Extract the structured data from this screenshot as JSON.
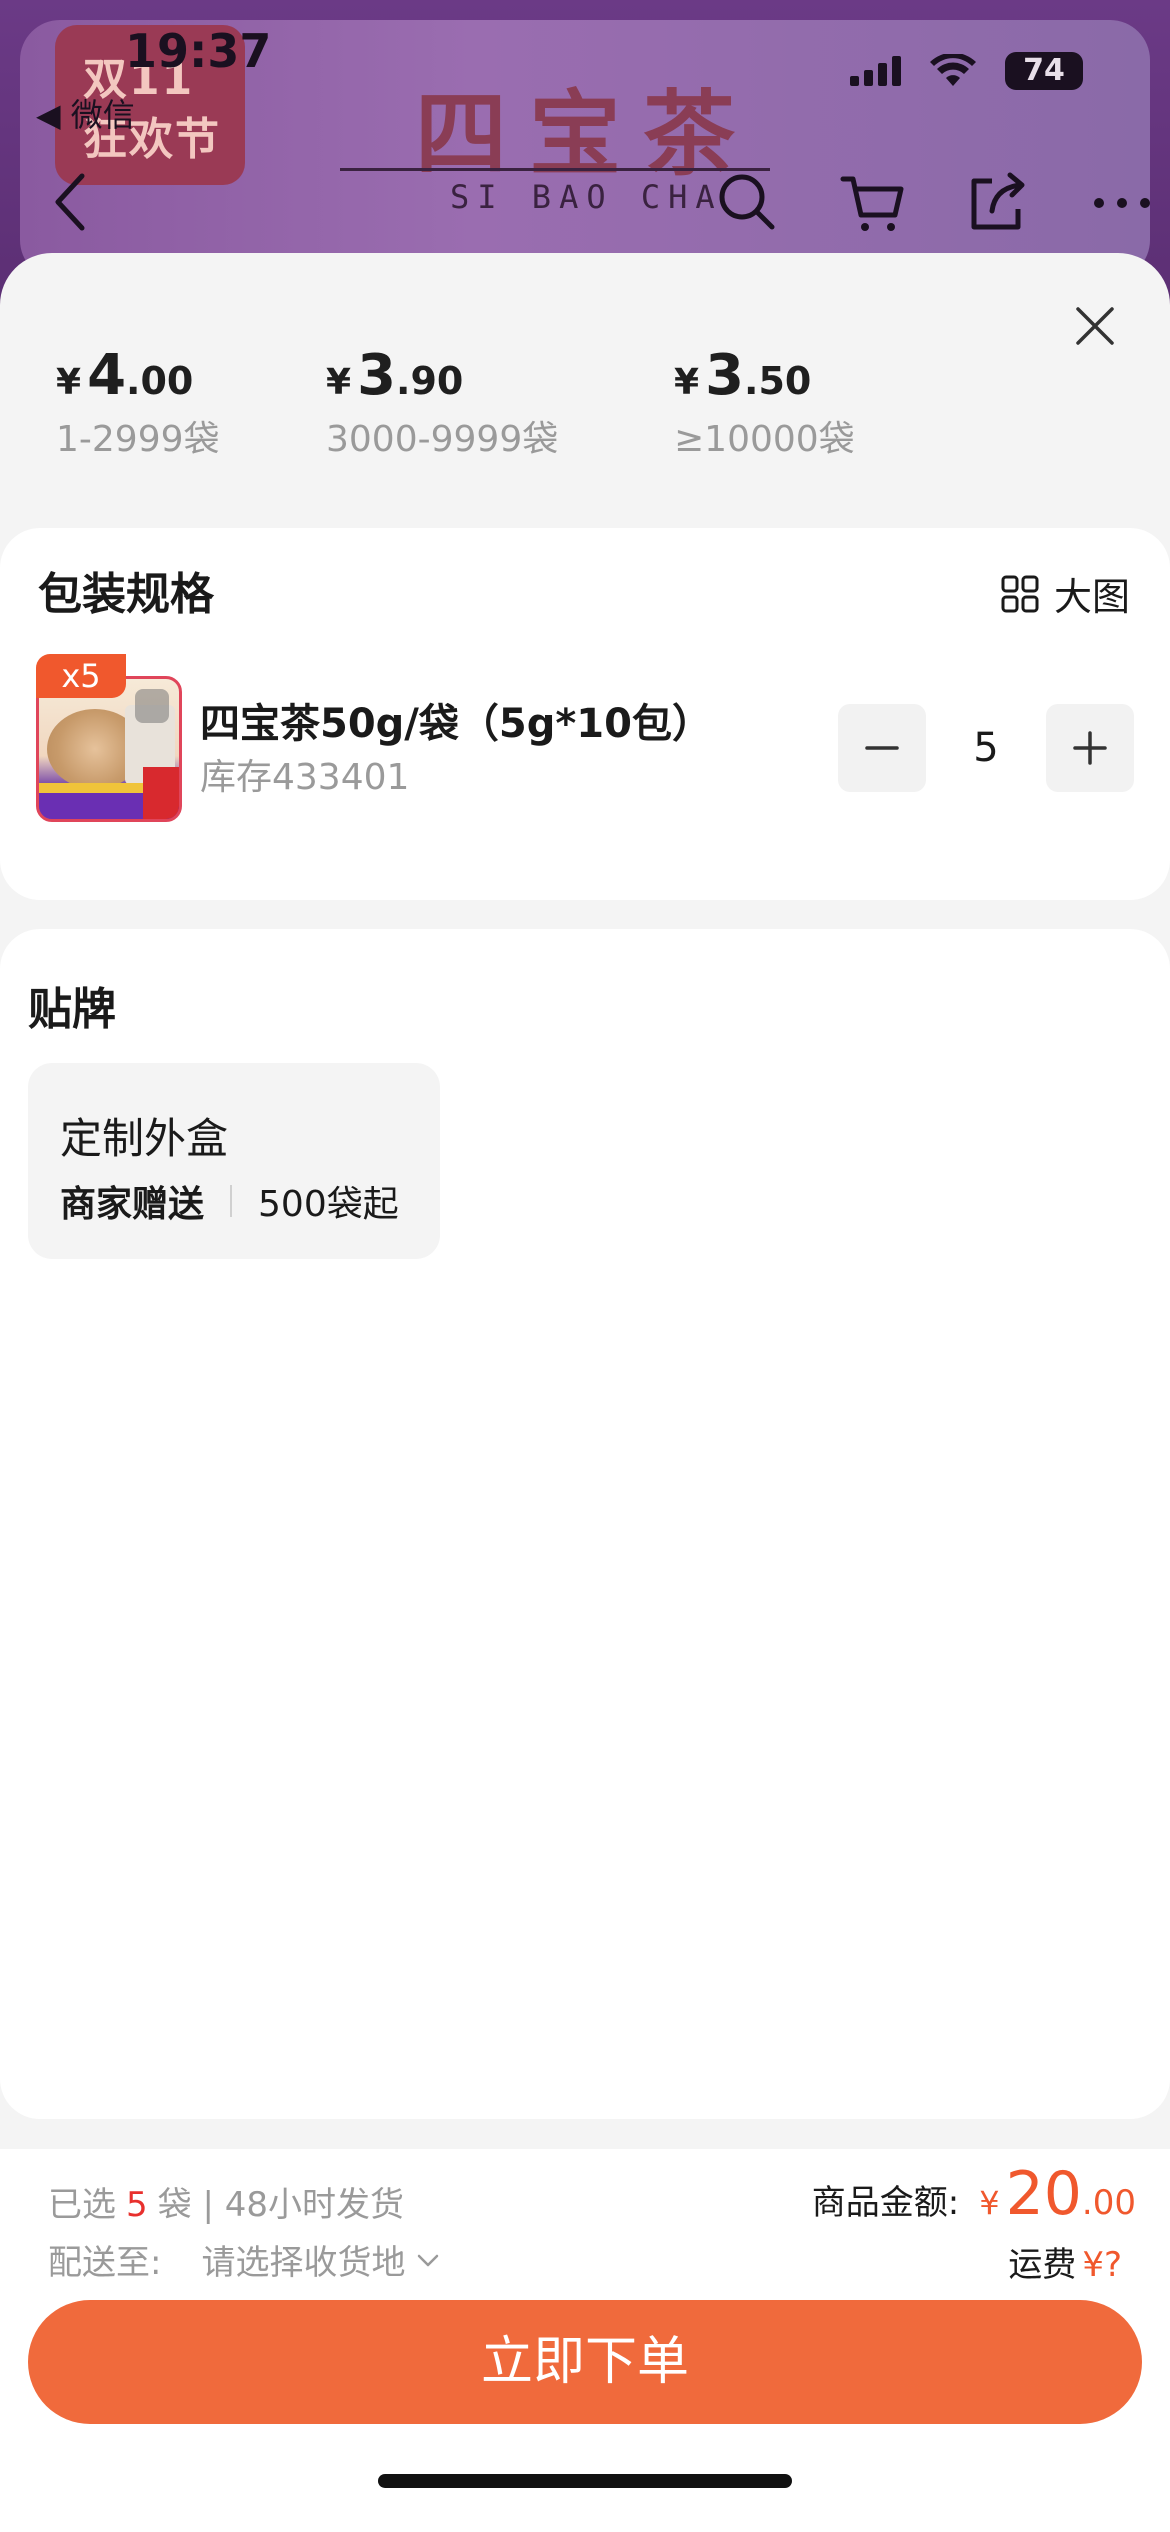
{
  "status_bar": {
    "time": "19:37",
    "back_app": "◀ 微信",
    "battery": "74"
  },
  "background_page": {
    "festival_badge": "双11\n狂欢节",
    "brand_name": "四宝茶",
    "brand_pinyin": "SI BAO CHA"
  },
  "price_tiers": [
    {
      "currency": "¥",
      "int": "4",
      "dec": ".00",
      "range": "1-2999袋"
    },
    {
      "currency": "¥",
      "int": "3",
      "dec": ".90",
      "range": "3000-9999袋"
    },
    {
      "currency": "¥",
      "int": "3",
      "dec": ".50",
      "range": "≥10000袋"
    }
  ],
  "spec_section": {
    "title": "包装规格",
    "big_picture_label": "大图",
    "product": {
      "qty_badge": "x5",
      "name": "四宝茶50g/袋（5g*10包）",
      "stock": "库存433401",
      "quantity": "5"
    }
  },
  "label_section": {
    "title": "贴牌",
    "option": {
      "title": "定制外盒",
      "gift": "商家赠送",
      "minimum": "500袋起"
    }
  },
  "footer": {
    "selected_prefix": "已选",
    "selected_count": "5",
    "selected_suffix": "袋 | 48小时发货",
    "ship_to_label": "配送至:",
    "ship_to_placeholder": "请选择收货地",
    "amount_label": "商品金额:",
    "amount_currency": "¥",
    "amount_int": "20",
    "amount_dec": ".00",
    "freight_label": "运费",
    "freight_value": "¥?",
    "order_button": "立即下单"
  },
  "colors": {
    "accent": "#f06a3c",
    "price_red": "#f0582d",
    "background_purple": "#5c2f74"
  }
}
